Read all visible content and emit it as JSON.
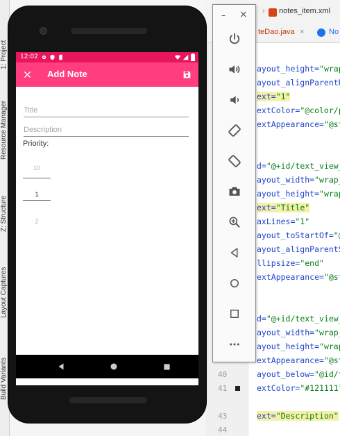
{
  "ide": {
    "left_tool_tabs": [
      "1: Project",
      "Resource Manager",
      "Z: Structure",
      "Layout Captures",
      "Build Variants"
    ],
    "editor_tabs": [
      {
        "label": "notes_item.xml",
        "color": "#d84315"
      },
      {
        "label": "teDao.java",
        "color": "#bf360c"
      },
      {
        "label": "No",
        "color": "#1a73e8"
      }
    ],
    "line_numbers": [
      "40",
      "41",
      "43",
      "44"
    ],
    "code_lines": [
      {
        "attr": "ayout_height=",
        "val": "\"wrap_"
      },
      {
        "attr": "ayout_alignParentR",
        "val": ""
      },
      {
        "attr": "ext=",
        "val": "\"1\""
      },
      {
        "attr": "extColor=",
        "val": "\"@color/p"
      },
      {
        "attr": "extAppearance=",
        "val": "\"@st"
      },
      {
        "attr": "d=",
        "val": "\"@+id/text_view_"
      },
      {
        "attr": "ayout_width=",
        "val": "\"wrap_"
      },
      {
        "attr": "ayout_height=",
        "val": "\"wrap_"
      },
      {
        "attr": "ext=",
        "val": "\"Title\""
      },
      {
        "attr": "axLines=",
        "val": "\"1\""
      },
      {
        "attr": "ayout_toStartOf=",
        "val": "\"@"
      },
      {
        "attr": "ayout_alignParentS",
        "val": ""
      },
      {
        "attr": "llipsize=",
        "val": "\"end\""
      },
      {
        "attr": "extAppearance=",
        "val": "\"@st"
      },
      {
        "attr": "d=",
        "val": "\"@+id/text_view_"
      },
      {
        "attr": "ayout_width=",
        "val": "\"wrap_"
      },
      {
        "attr": "ayout_height=",
        "val": "\"wrap_"
      },
      {
        "attr": "extAppearance=",
        "val": "\"@st"
      },
      {
        "attr": "ayout_below=",
        "val": "\"@id/t"
      },
      {
        "attr": "extColor=",
        "val": "\"#121111\""
      },
      {
        "attr": "ext=",
        "val": "\"Description\""
      }
    ]
  },
  "emulator_toolbar": {
    "minimize": "–",
    "close": "×",
    "buttons": [
      "power-icon",
      "volume-up-icon",
      "volume-down-icon",
      "rotate-left-icon",
      "rotate-right-icon",
      "camera-icon",
      "zoom-icon",
      "back-icon",
      "home-icon",
      "overview-icon",
      "more-icon"
    ]
  },
  "phone": {
    "status": {
      "time": "12:02"
    },
    "app_bar": {
      "title": "Add Note",
      "close": "×"
    },
    "form": {
      "title_placeholder": "Title",
      "title_value": "",
      "description_placeholder": "Description",
      "description_value": "",
      "priority_label": "Priority:",
      "picker": {
        "prev": "10",
        "selected": "1",
        "next": "2"
      }
    }
  },
  "colors": {
    "status_bar": "#e8175d",
    "app_bar": "#ff3d7f",
    "code_attr": "#1f44c9",
    "code_value": "#067d17"
  }
}
